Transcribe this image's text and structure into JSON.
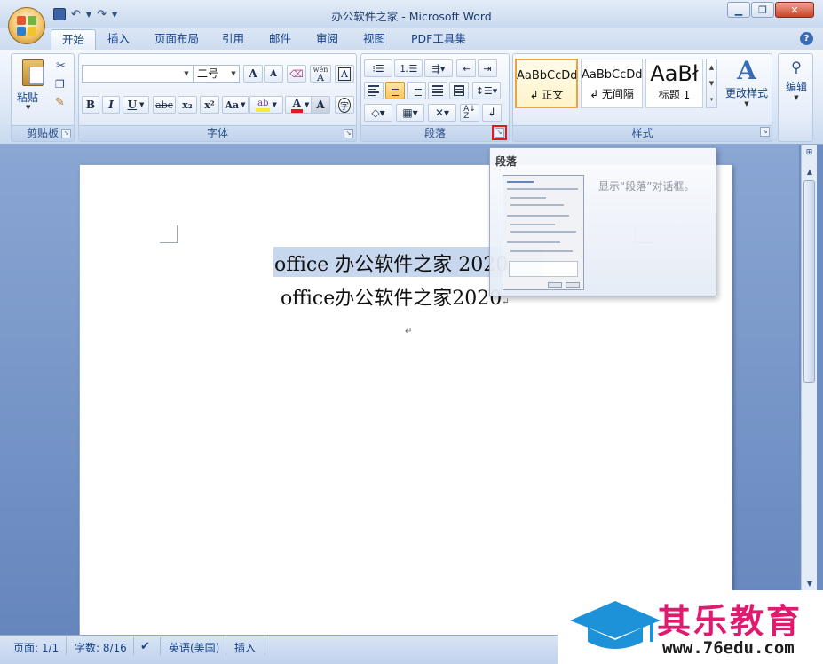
{
  "window": {
    "title": "办公软件之家 - Microsoft Word",
    "minimize": "▁",
    "restore": "❐",
    "close": "✕"
  },
  "qat": {
    "save_icon": "floppy-icon",
    "undo_icon": "undo-icon",
    "redo_icon": "redo-icon",
    "customize_icon": "chevron-down-icon"
  },
  "tabs": [
    {
      "label": "开始",
      "active": true
    },
    {
      "label": "插入"
    },
    {
      "label": "页面布局"
    },
    {
      "label": "引用"
    },
    {
      "label": "邮件"
    },
    {
      "label": "审阅"
    },
    {
      "label": "视图"
    },
    {
      "label": "PDF工具集"
    }
  ],
  "clipboard": {
    "label": "剪贴板",
    "paste": "粘贴"
  },
  "font": {
    "label": "字体",
    "font_name": "",
    "font_size": "二号",
    "bold": "B",
    "italic": "I",
    "underline": "U",
    "strike": "abc",
    "subscript": "x₂",
    "superscript": "x²",
    "case": "Aa",
    "grow": "A",
    "shrink": "A",
    "char_border": "A",
    "phonetic": "wén",
    "enclose": "字",
    "char_shading": "A",
    "font_color": "A",
    "accent_color": "#e01b1b",
    "highlight_color": "#f7ec3a"
  },
  "paragraph": {
    "label": "段落",
    "launcher": "↘"
  },
  "styles": {
    "label": "样式",
    "cards": [
      {
        "sample": "AaBbCcDd",
        "name": "↲ 正文",
        "selected": true
      },
      {
        "sample": "AaBbCcDd",
        "name": "↲ 无间隔"
      },
      {
        "sample": "AaBł",
        "name": "标题 1"
      }
    ],
    "change": "更改样式"
  },
  "editing": {
    "label": "编辑"
  },
  "tooltip": {
    "title": "段落",
    "description": "显示“段落”对话框。"
  },
  "document": {
    "line1": "office 办公软件之家 2020",
    "line2": "office办公软件之家2020",
    "para_mark": "↵"
  },
  "status": {
    "page": "页面: 1/1",
    "words": "字数: 8/16",
    "language": "英语(美国)",
    "mode": "插入"
  },
  "watermark": {
    "name": "其乐教育",
    "url": "www.76edu.com"
  },
  "colors": {
    "selection": "#c7d8ee",
    "highlight_box": "#e01b1b",
    "brand": "#e01a6f",
    "cap_blue": "#1d92d8"
  }
}
